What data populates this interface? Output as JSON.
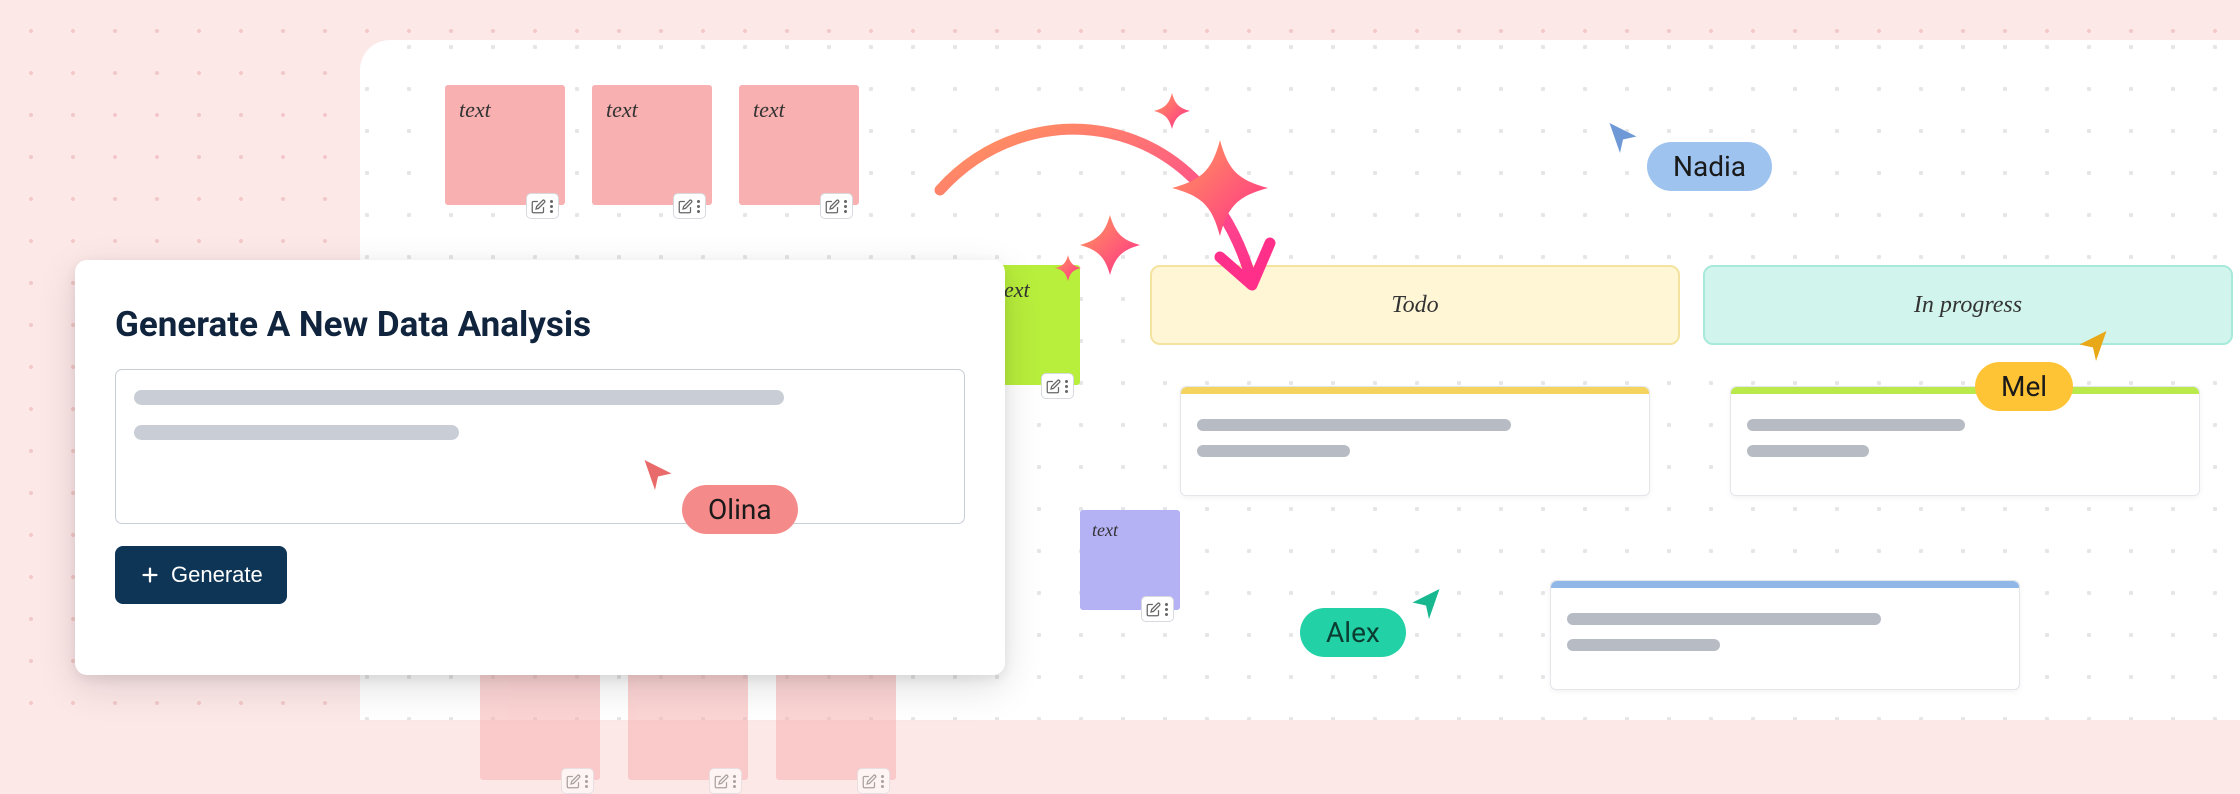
{
  "panel": {
    "title": "Generate A New Data Analysis",
    "button_label": "Generate"
  },
  "stickies": {
    "pink": [
      "text",
      "text",
      "text"
    ],
    "green": "ext",
    "purple": "text"
  },
  "columns": {
    "todo": "Todo",
    "in_progress": "In progress"
  },
  "cursors": {
    "olina": "Olina",
    "nadia": "Nadia",
    "alex": "Alex",
    "mel": "Mel"
  }
}
